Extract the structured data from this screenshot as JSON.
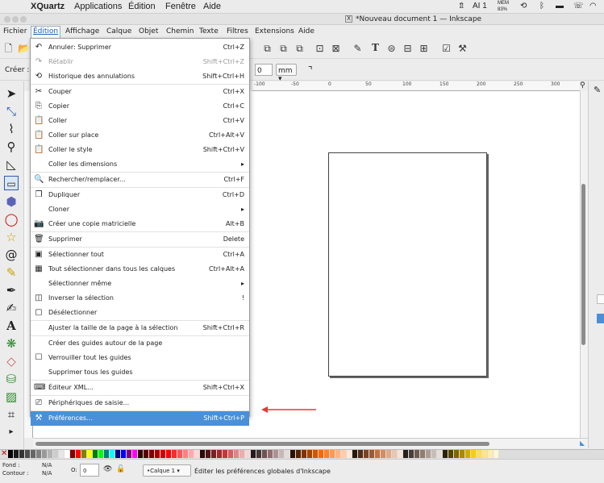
{
  "mac_menubar": {
    "apple": "",
    "app": "XQuartz",
    "items": [
      "Applications",
      "Édition",
      "Fenêtre",
      "Aide"
    ],
    "status": {
      "dropbox": "⇯",
      "adobe": "AI 1",
      "mem_label": "MEM",
      "mem_value": "83%",
      "time_machine": "⟲",
      "bluetooth": "ᛒ",
      "battery": "▬",
      "phone": "☏",
      "wifi": "◠"
    }
  },
  "window": {
    "title": "*Nouveau document 1 — Inkscape",
    "app_icon": "X"
  },
  "ink_menubar": [
    "Fichier",
    "Édition",
    "Affichage",
    "Calque",
    "Objet",
    "Chemin",
    "Texte",
    "Filtres",
    "Extensions",
    "Aide"
  ],
  "controls": {
    "label": "Créer :",
    "value": "0",
    "unit": "mm"
  },
  "ruler_ticks": [
    "-100",
    "-50",
    "0",
    "50",
    "100",
    "150",
    "200",
    "250",
    "300"
  ],
  "edit_menu": [
    {
      "icon": "↶",
      "label": "Annuler: Supprimer",
      "shortcut": "Ctrl+Z",
      "disabled": false
    },
    {
      "icon": "↷",
      "label": "Rétablir",
      "shortcut": "Shift+Ctrl+Z",
      "disabled": true
    },
    {
      "icon": "⟲",
      "label": "Historique des annulations",
      "shortcut": "Shift+Ctrl+H",
      "disabled": false
    },
    {
      "sep": true
    },
    {
      "icon": "✂",
      "label": "Couper",
      "shortcut": "Ctrl+X",
      "disabled": false
    },
    {
      "icon": "⎘",
      "label": "Copier",
      "shortcut": "Ctrl+C",
      "disabled": false
    },
    {
      "icon": "📋",
      "label": "Coller",
      "shortcut": "Ctrl+V",
      "disabled": false
    },
    {
      "icon": "📋",
      "label": "Coller sur place",
      "shortcut": "Ctrl+Alt+V",
      "disabled": false
    },
    {
      "icon": "📋",
      "label": "Coller le style",
      "shortcut": "Shift+Ctrl+V",
      "disabled": false
    },
    {
      "icon": "",
      "label": "Coller les dimensions",
      "shortcut": "▸",
      "disabled": false
    },
    {
      "sep": true
    },
    {
      "icon": "🔍",
      "label": "Rechercher/remplacer...",
      "shortcut": "Ctrl+F",
      "disabled": false
    },
    {
      "sep": true
    },
    {
      "icon": "❐",
      "label": "Dupliquer",
      "shortcut": "Ctrl+D",
      "disabled": false
    },
    {
      "icon": "",
      "label": "Cloner",
      "shortcut": "▸",
      "disabled": false
    },
    {
      "icon": "📷",
      "label": "Créer une copie matricielle",
      "shortcut": "Alt+B",
      "disabled": false
    },
    {
      "sep": true
    },
    {
      "icon": "🗑",
      "label": "Supprimer",
      "shortcut": "Delete",
      "disabled": false
    },
    {
      "sep": true
    },
    {
      "icon": "▣",
      "label": "Sélectionner tout",
      "shortcut": "Ctrl+A",
      "disabled": false
    },
    {
      "icon": "▦",
      "label": "Tout sélectionner dans tous les calques",
      "shortcut": "Ctrl+Alt+A",
      "disabled": false
    },
    {
      "icon": "",
      "label": "Sélectionner même",
      "shortcut": "▸",
      "disabled": false
    },
    {
      "icon": "◫",
      "label": "Inverser la sélection",
      "shortcut": "!",
      "disabled": false
    },
    {
      "icon": "▢",
      "label": "Désélectionner",
      "shortcut": "",
      "disabled": false
    },
    {
      "sep": true
    },
    {
      "icon": "",
      "label": "Ajuster la taille de la page à la sélection",
      "shortcut": "Shift+Ctrl+R",
      "disabled": false
    },
    {
      "sep": true
    },
    {
      "icon": "",
      "label": "Créer des guides autour de la page",
      "shortcut": "",
      "disabled": false
    },
    {
      "icon": "☐",
      "label": "Verrouiller tout les guides",
      "shortcut": "",
      "disabled": false
    },
    {
      "icon": "",
      "label": "Supprimer tous les guides",
      "shortcut": "",
      "disabled": false
    },
    {
      "sep": true
    },
    {
      "icon": "⌨",
      "label": "Éditeur XML...",
      "shortcut": "Shift+Ctrl+X",
      "disabled": false
    },
    {
      "sep": true
    },
    {
      "icon": "⎚",
      "label": "Périphériques de saisie...",
      "shortcut": "",
      "disabled": false
    },
    {
      "sep": true
    },
    {
      "icon": "⚒",
      "label": "Préférences...",
      "shortcut": "Shift+Ctrl+P",
      "disabled": false,
      "highlight": true
    }
  ],
  "status": {
    "fill_label": "Fond :",
    "fill_value": "N/A",
    "stroke_label": "Contour :",
    "stroke_value": "N/A",
    "opacity_label": "O:",
    "opacity_value": "0",
    "layer": "•Calque 1",
    "message": "Éditer les préférences globales d'Inkscape"
  },
  "colors": {
    "highlight": "#4a90d9",
    "annotation_arrow": "#e53935",
    "palette": [
      "#000000",
      "#1a1a1a",
      "#333333",
      "#4d4d4d",
      "#666666",
      "#808080",
      "#999999",
      "#b3b3b3",
      "#cccccc",
      "#e6e6e6",
      "#ffffff",
      "#800000",
      "#ff0000",
      "#808000",
      "#ffff00",
      "#008000",
      "#00ff00",
      "#008080",
      "#00ffff",
      "#000080",
      "#0000ff",
      "#800080",
      "#ff00ff",
      "#2b0000",
      "#550000",
      "#800000",
      "#aa0000",
      "#d40000",
      "#ff0000",
      "#ff2a2a",
      "#ff5555",
      "#ff8080",
      "#ffaaaa",
      "#ffd5d5",
      "#280b0b",
      "#501616",
      "#782121",
      "#a02c2c",
      "#c83737",
      "#d35f5f",
      "#de8787",
      "#e9afaf",
      "#f4d7d7",
      "#241c1c",
      "#483737",
      "#6c5353",
      "#916f6f",
      "#ac9393",
      "#c8b7b7",
      "#e3dbdb",
      "#2b1100",
      "#552200",
      "#803300",
      "#aa4400",
      "#d45500",
      "#ff6600",
      "#ff7f2a",
      "#ff9955",
      "#ffb380",
      "#ffccaa",
      "#ffe6d5",
      "#28170b",
      "#502d16",
      "#784421",
      "#a05a2c",
      "#c87137",
      "#d38d5f",
      "#deaa87",
      "#e9c6af",
      "#f4e3d7",
      "#241f1c",
      "#483e37",
      "#6c5d53",
      "#917c6f",
      "#ac9d93",
      "#c8beb7",
      "#e3dedb",
      "#2b2200",
      "#554400",
      "#806600",
      "#aa8800",
      "#d4aa00",
      "#ffcc00",
      "#ffdd55",
      "#ffe680",
      "#ffeeaa",
      "#fff6d5"
    ]
  }
}
